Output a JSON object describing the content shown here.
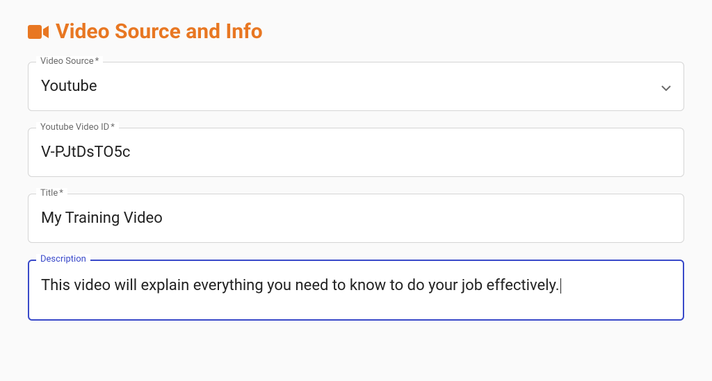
{
  "header": {
    "title": "Video Source and Info",
    "icon": "video-camera-icon"
  },
  "fields": {
    "video_source": {
      "label": "Video Source",
      "required_mark": "*",
      "value": "Youtube"
    },
    "youtube_id": {
      "label": "Youtube Video ID",
      "required_mark": "*",
      "value": "V-PJtDsTO5c"
    },
    "title": {
      "label": "Title",
      "required_mark": "*",
      "value": "My Training Video"
    },
    "description": {
      "label": "Description",
      "value": "This video will explain everything you need to know to do your job effectively."
    }
  }
}
